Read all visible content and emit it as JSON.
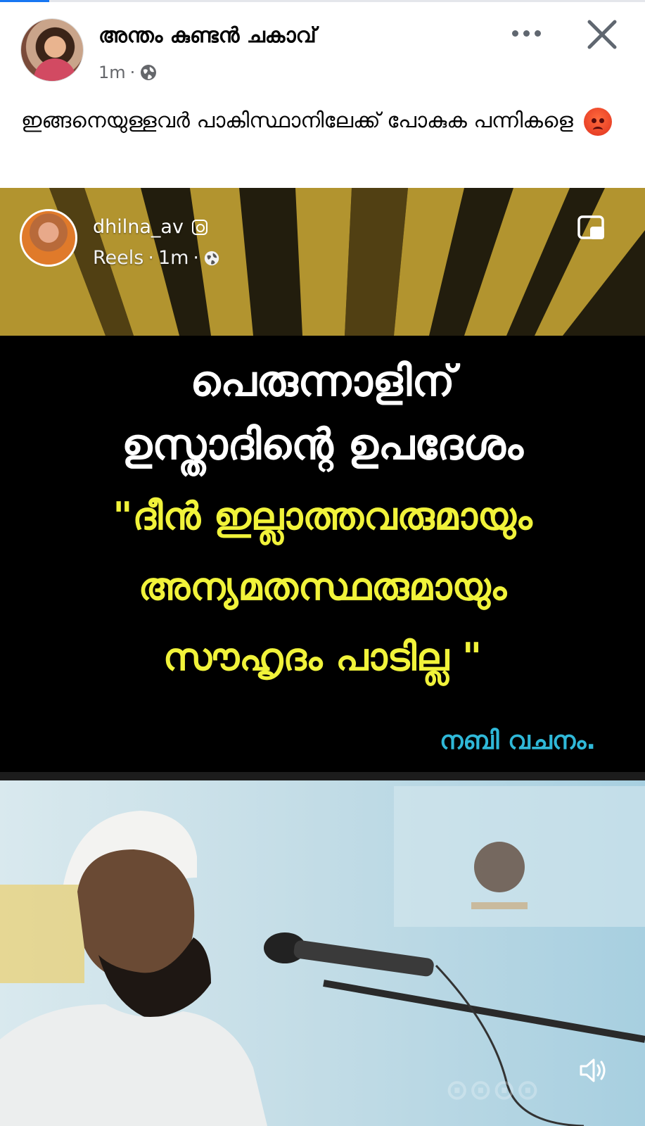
{
  "post": {
    "author": "അന്തം കുണ്ടൻ ചകാവ്",
    "time": "1m",
    "caption": "ഇങ്ങനെയുള്ളവർ പാകിസ്ഥാനിലേക്ക് പോകുക പന്നികളെ",
    "icons": {
      "more": "more-options-icon",
      "close": "close-icon",
      "audience": "globe-icon"
    }
  },
  "reel": {
    "username": "dhilna_av",
    "source": "Reels",
    "time": "1m",
    "title_line1": "പെരുന്നാളിന്",
    "title_line2": "ഉസ്താദിന്റെ ഉപദേശം",
    "quote_line1": "\"ദീൻ ഇല്ലാത്തവരുമായും",
    "quote_line2": "അന്യമതസ്ഥരുമായും",
    "quote_line3": "സൗഹൃദം പാടില്ല \"",
    "attribution": "നബി വചനം.",
    "colors": {
      "title": "#ffffff",
      "quote": "#f1f33a",
      "attribution": "#2fb8d8"
    }
  }
}
